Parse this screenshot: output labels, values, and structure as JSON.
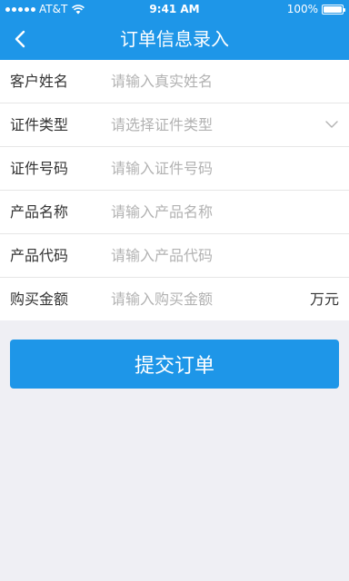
{
  "status_bar": {
    "carrier": "AT&T",
    "time": "9:41 AM",
    "battery": "100%",
    "signal_icon": "signal-dots-icon",
    "wifi_icon": "wifi-icon",
    "battery_icon": "battery-icon"
  },
  "nav": {
    "title": "订单信息录入",
    "back_icon": "chevron-left-icon"
  },
  "form": {
    "fields": [
      {
        "label": "客户姓名",
        "placeholder": "请输入真实姓名",
        "value": ""
      },
      {
        "label": "证件类型",
        "placeholder": "请选择证件类型",
        "value": "",
        "icon": "chevron-down-icon"
      },
      {
        "label": "证件号码",
        "placeholder": "请输入证件号码",
        "value": ""
      },
      {
        "label": "产品名称",
        "placeholder": "请输入产品名称",
        "value": ""
      },
      {
        "label": "产品代码",
        "placeholder": "请输入产品代码",
        "value": ""
      },
      {
        "label": "购买金额",
        "placeholder": "请输入购买金额",
        "value": "",
        "unit": "万元"
      }
    ]
  },
  "actions": {
    "submit_label": "提交订单"
  },
  "colors": {
    "primary": "#1e96e8",
    "background": "#efeff4",
    "placeholder": "#b2b2b2",
    "text": "#333333"
  }
}
